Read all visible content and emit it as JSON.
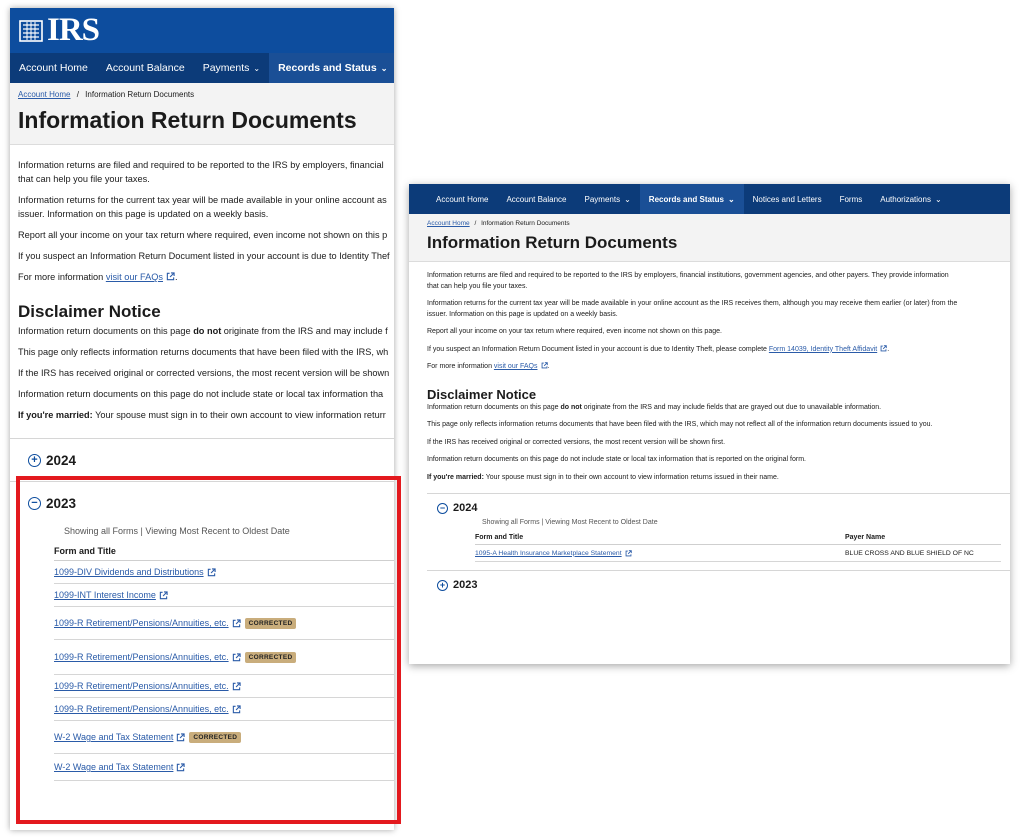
{
  "logo": {
    "text": "IRS"
  },
  "nav_left": [
    {
      "label": "Account Home",
      "caret": false,
      "active": false
    },
    {
      "label": "Account Balance",
      "caret": false,
      "active": false
    },
    {
      "label": "Payments",
      "caret": true,
      "active": false
    },
    {
      "label": "Records and Status",
      "caret": true,
      "active": true
    }
  ],
  "nav_right": [
    {
      "label": "Account Home",
      "caret": false,
      "active": false
    },
    {
      "label": "Account Balance",
      "caret": false,
      "active": false
    },
    {
      "label": "Payments",
      "caret": true,
      "active": false
    },
    {
      "label": "Records and Status",
      "caret": true,
      "active": true
    },
    {
      "label": "Notices and Letters",
      "caret": false,
      "active": false
    },
    {
      "label": "Forms",
      "caret": false,
      "active": false
    },
    {
      "label": "Authorizations",
      "caret": true,
      "active": false
    }
  ],
  "breadcrumb": {
    "home": "Account Home",
    "separator": "/",
    "current": "Information Return Documents"
  },
  "page_title": "Information Return Documents",
  "intro": {
    "p1_left": "Information returns are filed and required to be reported to the IRS by employers, financial",
    "p1_left_2": "that can help you file your taxes.",
    "p2_left": "Information returns for the current tax year will be made available in your online account as",
    "p2_left_2": "issuer. Information on this page is updated on a weekly basis.",
    "p3_left": "Report all your income on your tax return where required, even income not shown on this p",
    "p4_left": "If you suspect an Information Return Document listed in your account is due to Identity Thef",
    "p5_prefix": "For more information ",
    "p5_link": "visit our FAQs",
    "p1_right": "Information returns are filed and required to be reported to the IRS by employers, financial institutions, government agencies, and other payers. They provide information",
    "p1_right_2": "that can help you file your taxes.",
    "p2_right": "Information returns for the current tax year will be made available in your online account as the IRS receives them, although you may receive them earlier (or later) from the",
    "p2_right_2": "issuer. Information on this page is updated on a weekly basis.",
    "p3_right": "Report all your income on your tax return where required, even income not shown on this page.",
    "p4_right_prefix": "If you suspect an Information Return Document listed in your account is due to Identity Theft, please complete ",
    "p4_right_link": "Form 14039, Identity Theft Affidavit"
  },
  "disclaimer": {
    "title": "Disclaimer Notice",
    "d1_prefix": "Information return documents on this page ",
    "d1_bold": "do not",
    "d1_left_suffix": " originate from the IRS and may include f",
    "d1_right_suffix": " originate from the IRS and may include fields that are grayed out due to unavailable information.",
    "d2_left": "This page only reflects information returns documents that have been filed with the IRS, wh",
    "d2_right": "This page only reflects information returns documents that have been filed with the IRS, which may not reflect all of the information return documents issued to you.",
    "d3_left": "If the IRS has received original or corrected versions, the most recent version will be shown",
    "d3_right": "If the IRS has received original or corrected versions, the most recent version will be shown first.",
    "d4_left": "Information return documents on this page do not include state or local tax information tha",
    "d4_right": "Information return documents on this page do not include state or local tax information that is reported on the original form.",
    "married_bold": "If you're married:",
    "married_left": " Your spouse must sign in to their own account to view information returr",
    "married_right": " Your spouse must sign in to their own account to view information returns issued in their name."
  },
  "years": {
    "y2024": "2024",
    "y2023": "2023",
    "plus": "+",
    "minus": "−"
  },
  "table": {
    "note": "Showing all Forms | Viewing Most Recent to Oldest Date",
    "col_form": "Form and Title",
    "col_payer": "Payer Name",
    "corrected_badge": "CORRECTED",
    "left_rows": [
      {
        "form": "1099-DIV Dividends and Distributions",
        "corrected": false
      },
      {
        "form": "1099-INT Interest Income",
        "corrected": false
      },
      {
        "form": "1099-R Retirement/Pensions/Annuities, etc.",
        "corrected": true
      },
      {
        "form": "1099-R Retirement/Pensions/Annuities, etc.",
        "corrected": true
      },
      {
        "form": "1099-R Retirement/Pensions/Annuities, etc.",
        "corrected": false
      },
      {
        "form": "1099-R Retirement/Pensions/Annuities, etc.",
        "corrected": false
      },
      {
        "form": "W-2 Wage and Tax Statement",
        "corrected": true
      },
      {
        "form": "W-2 Wage and Tax Statement",
        "corrected": false
      }
    ],
    "right_row": {
      "form": "1095-A Health Insurance Marketplace Statement",
      "payer": "BLUE CROSS AND BLUE SHIELD OF NC"
    }
  },
  "colors": {
    "header_blue": "#0d4d9e",
    "nav_blue": "#0c3b79",
    "link": "#2a5ba8",
    "highlight_box": "#e3191e",
    "badge": "#c9ad7c"
  }
}
